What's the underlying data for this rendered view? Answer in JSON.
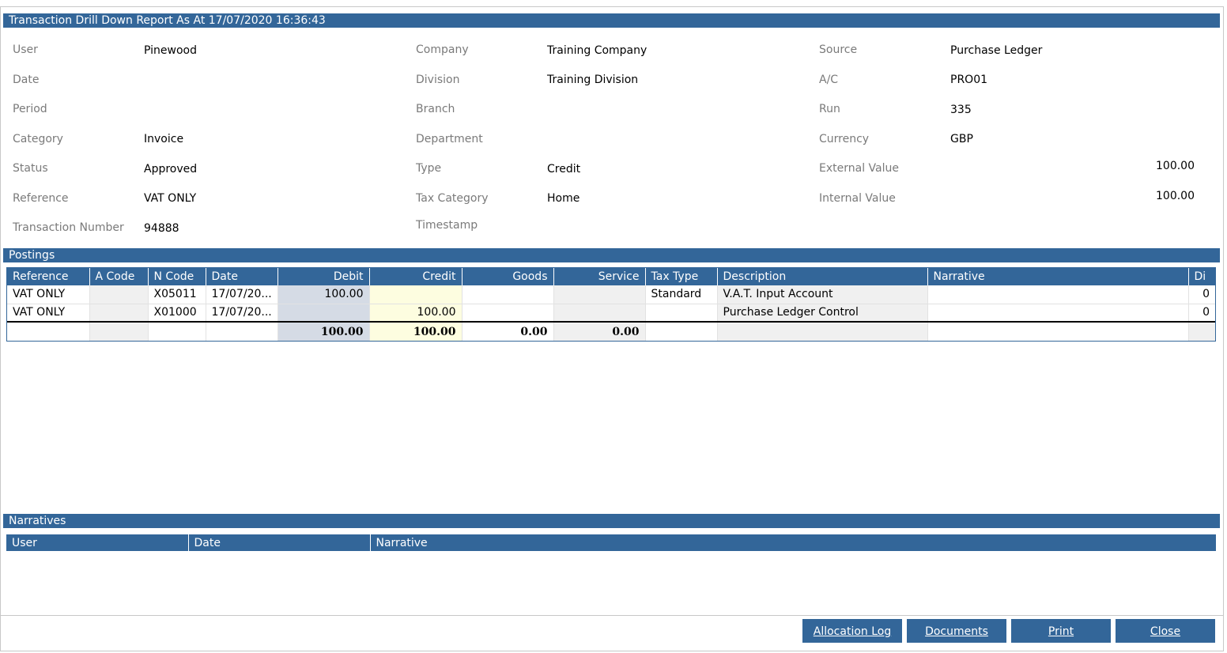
{
  "title": "Transaction Drill Down Report As At 17/07/2020 16:36:43",
  "col1": [
    {
      "label": "User",
      "value": "Pinewood"
    },
    {
      "label": "Date",
      "value": ""
    },
    {
      "label": "Period",
      "value": ""
    },
    {
      "label": "Category",
      "value": "Invoice"
    },
    {
      "label": "Status",
      "value": "Approved"
    },
    {
      "label": "Reference",
      "value": "VAT ONLY"
    },
    {
      "label": "Transaction Number",
      "value": "94888"
    }
  ],
  "col2": [
    {
      "label": "Company",
      "value": "Training Company"
    },
    {
      "label": "Division",
      "value": "Training Division"
    },
    {
      "label": "Branch",
      "value": ""
    },
    {
      "label": "Department",
      "value": ""
    },
    {
      "label": "Type",
      "value": "Credit"
    },
    {
      "label": "Tax Category",
      "value": "Home"
    },
    {
      "label": "Timestamp",
      "value": ""
    }
  ],
  "col3": [
    {
      "label": "Source",
      "value": "Purchase Ledger"
    },
    {
      "label": "A/C",
      "value": "PRO01"
    },
    {
      "label": "Run",
      "value": "335"
    },
    {
      "label": "Currency",
      "value": "GBP"
    },
    {
      "label": "External Value",
      "value": "100.00"
    },
    {
      "label": "Internal Value",
      "value": "100.00"
    }
  ],
  "postings": {
    "title": "Postings",
    "columns": [
      "Reference",
      "A Code",
      "N Code",
      "Date",
      "Debit",
      "Credit",
      "Goods",
      "Service",
      "Tax Type",
      "Description",
      "Narrative",
      "Di"
    ],
    "rows": [
      [
        "VAT ONLY",
        "",
        "X05011",
        "17/07/20...",
        "100.00",
        "",
        "",
        "",
        "Standard",
        "V.A.T. Input Account",
        "",
        "0"
      ],
      [
        "VAT ONLY",
        "",
        "X01000",
        "17/07/20...",
        "",
        "100.00",
        "",
        "",
        "",
        "Purchase Ledger Control",
        "",
        "0"
      ]
    ],
    "totals": {
      "debit": "100.00",
      "credit": "100.00",
      "goods": "0.00",
      "service": "0.00"
    }
  },
  "narratives": {
    "title": "Narratives",
    "columns": [
      "User",
      "Date",
      "Narrative"
    ]
  },
  "buttons": {
    "allocation_log": "Allocation Log",
    "documents": "Documents",
    "print": "Print",
    "close": "Close"
  },
  "colors": {
    "header_blue": "#336699",
    "debit_bg": "#d5dbe5",
    "credit_bg": "#fdfde0"
  }
}
